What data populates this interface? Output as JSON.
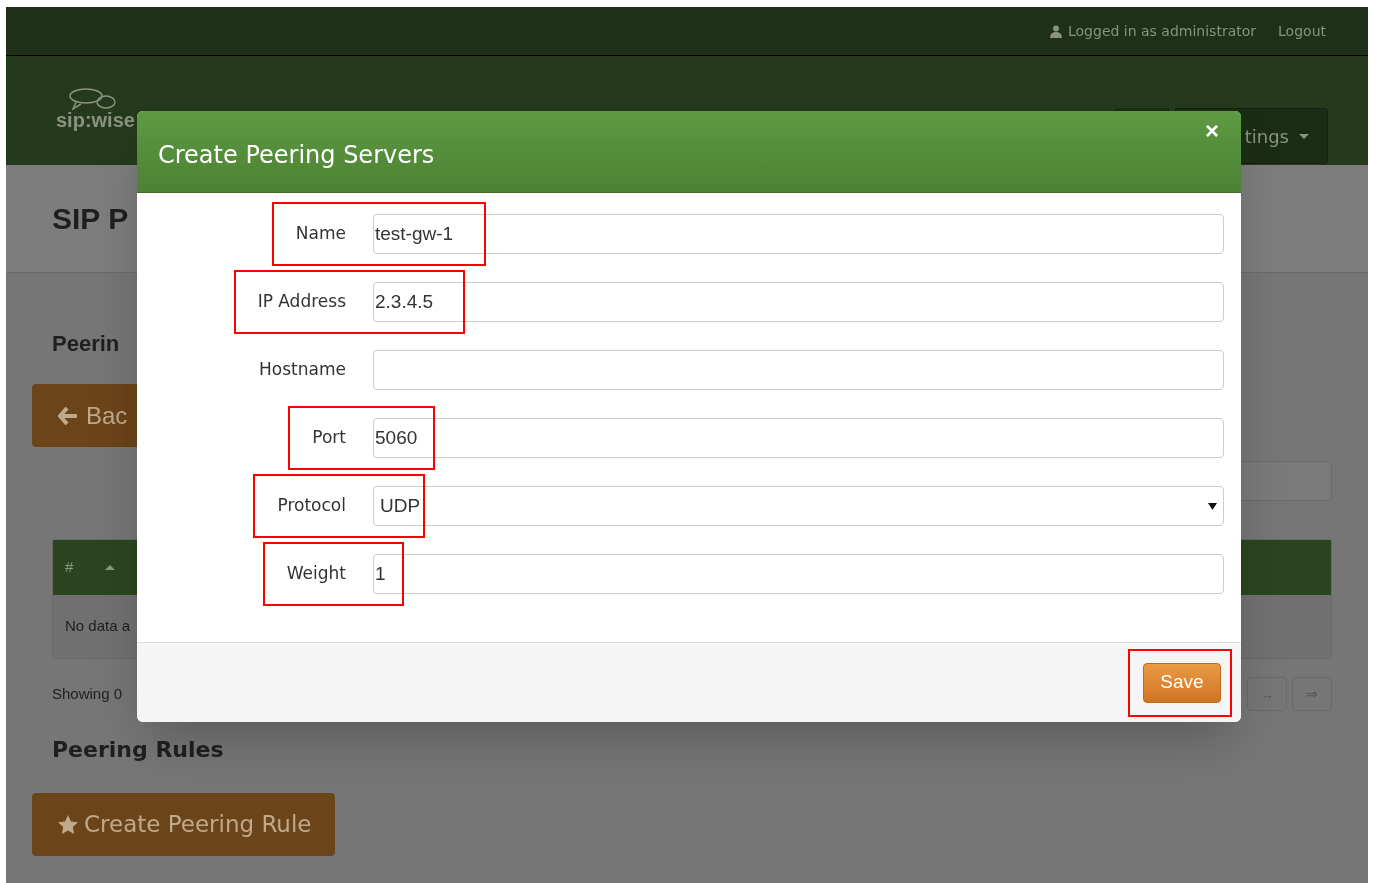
{
  "top_bar": {
    "user": "Logged in as administrator",
    "logout": "Logout"
  },
  "nav": {
    "logo": "sip:wise",
    "menu_item": "tings"
  },
  "page": {
    "title": "SIP P",
    "section_1": "Peerin",
    "back_button": "Bac",
    "table": {
      "column_1": "#",
      "empty": "No data a"
    },
    "showing": "Showing 0",
    "pagination": [
      "→",
      "⇒"
    ],
    "section_2": "Peering Rules",
    "create_button": "Create Peering Rule"
  },
  "modal": {
    "title": "Create Peering Servers",
    "close": "×",
    "fields": [
      {
        "label": "Name",
        "kind": "text",
        "value": "test-gw-1",
        "highlighted": true
      },
      {
        "label": "IP Address",
        "kind": "text",
        "value": "2.3.4.5",
        "highlighted": true
      },
      {
        "label": "Hostname",
        "kind": "text",
        "highlighted": false
      },
      {
        "label": "Port",
        "kind": "text",
        "value": "5060",
        "highlighted": true
      },
      {
        "label": "Protocol",
        "kind": "select",
        "value": "UDP",
        "highlighted": true
      },
      {
        "label": "Weight",
        "kind": "text",
        "value": "1",
        "highlighted": true
      }
    ],
    "save": "Save",
    "save_highlighted": true
  }
}
